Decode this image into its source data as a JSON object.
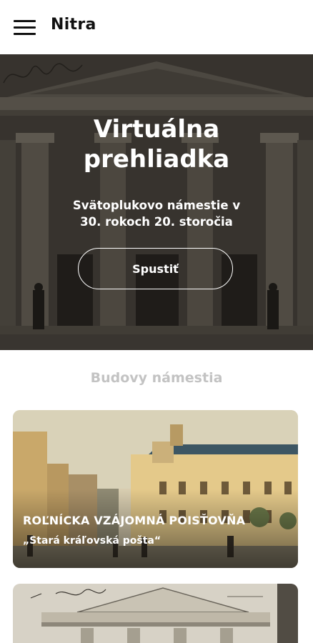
{
  "header": {
    "title": "Nitra",
    "menu_icon": "hamburger-menu-icon"
  },
  "hero": {
    "title_line1": "Virtuálna",
    "title_line2": "prehliadka",
    "subtitle_line1": "Svätoplukovo námestie v",
    "subtitle_line2": "30. rokoch 20. storočia",
    "start_button": "Spustiť"
  },
  "section": {
    "title": "Budovy námestia"
  },
  "cards": [
    {
      "title": "ROĽNÍCKA VZÁJOMNÁ POISŤOVŇA",
      "subtitle": "„Stará kráľovská pošta“"
    }
  ]
}
